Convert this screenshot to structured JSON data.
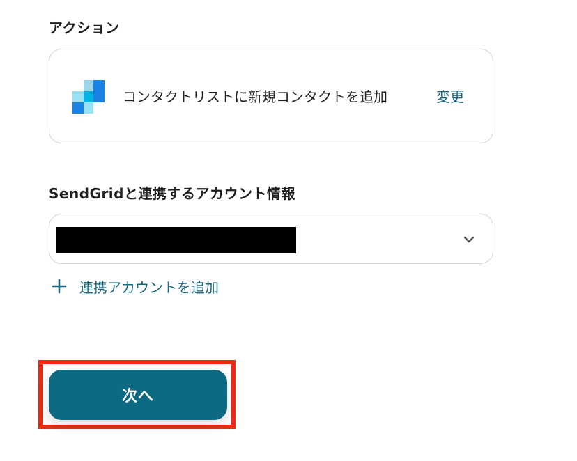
{
  "action_section": {
    "label": "アクション",
    "action_text": "コンタクトリストに新規コンタクトを追加",
    "change_label": "変更"
  },
  "account_section": {
    "label": "SendGridと連携するアカウント情報",
    "add_account_label": "連携アカウントを追加"
  },
  "footer": {
    "next_label": "次へ"
  },
  "icons": {
    "service_logo": "sendgrid-logo",
    "dropdown": "chevron-down-icon",
    "add": "plus-icon"
  },
  "colors": {
    "accent": "#17667e",
    "primary_button": "#0d6a82",
    "highlight": "#ee2a12"
  }
}
